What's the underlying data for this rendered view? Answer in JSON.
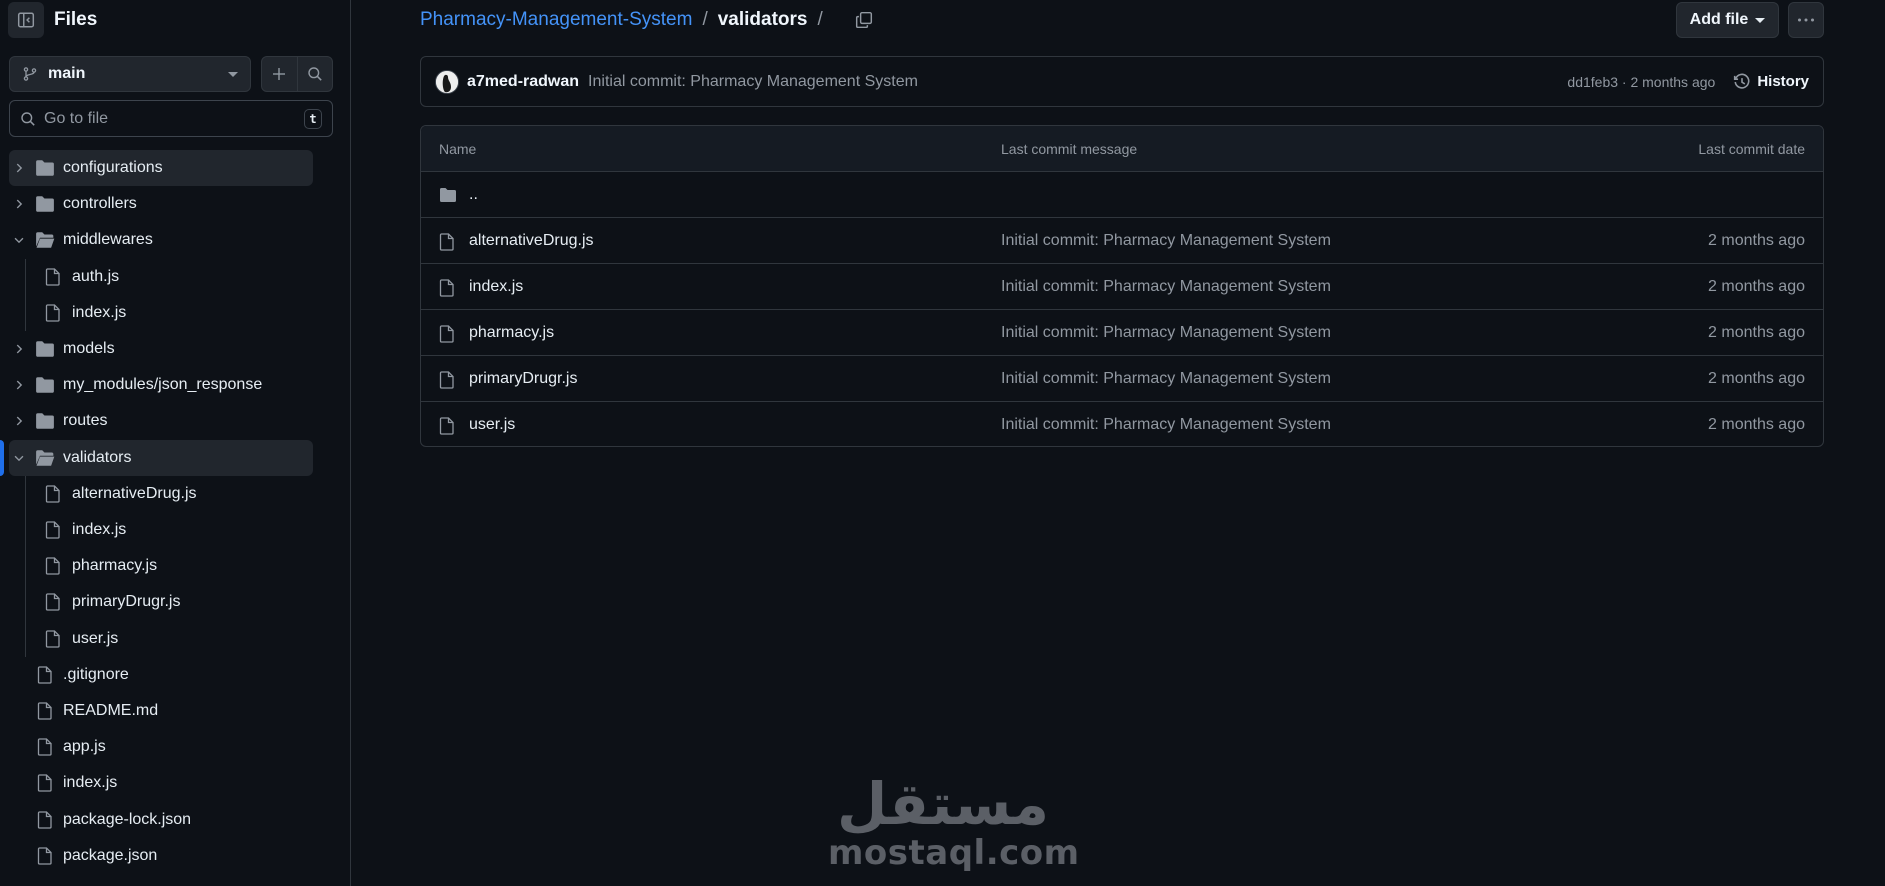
{
  "sidebar": {
    "title": "Files",
    "branch": "main",
    "search_placeholder": "Go to file",
    "search_shortcut": "t",
    "tree": [
      {
        "type": "folder",
        "name": "configurations",
        "depth": 0,
        "expanded": false,
        "selected": true
      },
      {
        "type": "folder",
        "name": "controllers",
        "depth": 0,
        "expanded": false
      },
      {
        "type": "folder",
        "name": "middlewares",
        "depth": 0,
        "expanded": true
      },
      {
        "type": "file",
        "name": "auth.js",
        "depth": 1
      },
      {
        "type": "file",
        "name": "index.js",
        "depth": 1
      },
      {
        "type": "folder",
        "name": "models",
        "depth": 0,
        "expanded": false
      },
      {
        "type": "folder",
        "name": "my_modules/json_response",
        "depth": 0,
        "expanded": false
      },
      {
        "type": "folder",
        "name": "routes",
        "depth": 0,
        "expanded": false
      },
      {
        "type": "folder",
        "name": "validators",
        "depth": 0,
        "expanded": true,
        "active": true
      },
      {
        "type": "file",
        "name": "alternativeDrug.js",
        "depth": 1
      },
      {
        "type": "file",
        "name": "index.js",
        "depth": 1
      },
      {
        "type": "file",
        "name": "pharmacy.js",
        "depth": 1
      },
      {
        "type": "file",
        "name": "primaryDrugr.js",
        "depth": 1
      },
      {
        "type": "file",
        "name": "user.js",
        "depth": 1
      },
      {
        "type": "file",
        "name": ".gitignore",
        "depth": 0
      },
      {
        "type": "file",
        "name": "README.md",
        "depth": 0
      },
      {
        "type": "file",
        "name": "app.js",
        "depth": 0
      },
      {
        "type": "file",
        "name": "index.js",
        "depth": 0
      },
      {
        "type": "file",
        "name": "package-lock.json",
        "depth": 0
      },
      {
        "type": "file",
        "name": "package.json",
        "depth": 0
      }
    ]
  },
  "breadcrumb": {
    "repo": "Pharmacy-Management-System",
    "separator": "/",
    "current": "validators",
    "trailing_separator": "/"
  },
  "toolbar": {
    "add_file_label": "Add file"
  },
  "latest_commit": {
    "author": "a7med-radwan",
    "message": "Initial commit: Pharmacy Management System",
    "meta": "dd1feb3 · 2 months ago",
    "history_label": "History"
  },
  "table": {
    "headers": {
      "name": "Name",
      "message": "Last commit message",
      "date": "Last commit date"
    },
    "parent_dir": "..",
    "rows": [
      {
        "name": "alternativeDrug.js",
        "message": "Initial commit: Pharmacy Management System",
        "date": "2 months ago"
      },
      {
        "name": "index.js",
        "message": "Initial commit: Pharmacy Management System",
        "date": "2 months ago"
      },
      {
        "name": "pharmacy.js",
        "message": "Initial commit: Pharmacy Management System",
        "date": "2 months ago"
      },
      {
        "name": "primaryDrugr.js",
        "message": "Initial commit: Pharmacy Management System",
        "date": "2 months ago"
      },
      {
        "name": "user.js",
        "message": "Initial commit: Pharmacy Management System",
        "date": "2 months ago"
      }
    ]
  },
  "watermark": {
    "arabic": "مستقل",
    "latin": "mostaql.com"
  },
  "colors": {
    "background": "#0d1117",
    "link": "#4493f8",
    "border": "#30363d",
    "muted": "#9198a1",
    "accent": "#1f6feb"
  }
}
